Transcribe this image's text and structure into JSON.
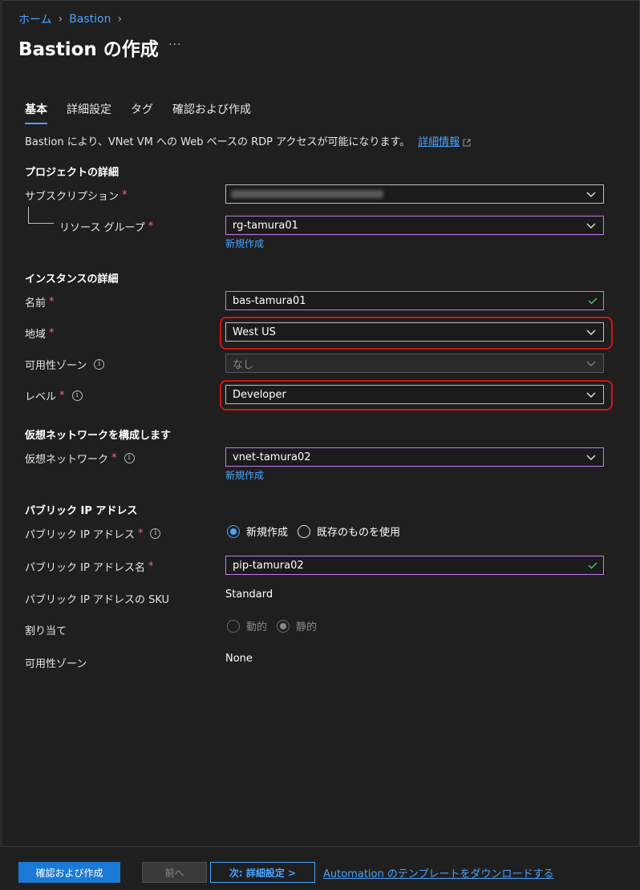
{
  "breadcrumb": {
    "home": "ホーム",
    "sep": "›",
    "bastion": "Bastion"
  },
  "page_title": "Bastion の作成",
  "more_label": "···",
  "tabs": [
    {
      "label": "基本",
      "active": true
    },
    {
      "label": "詳細設定",
      "active": false
    },
    {
      "label": "タグ",
      "active": false
    },
    {
      "label": "確認および作成",
      "active": false
    }
  ],
  "intro": {
    "text": "Bastion により、VNet VM への Web ベースの RDP アクセスが可能になります。",
    "link": "詳細情報"
  },
  "sections": {
    "project": "プロジェクトの詳細",
    "instance": "インスタンスの詳細",
    "vnet": "仮想ネットワークを構成します",
    "public_ip": "パブリック IP アドレス"
  },
  "fields": {
    "subscription": {
      "label": "サブスクリプション",
      "required": "*"
    },
    "resource_group": {
      "label": "リソース グループ",
      "required": "*",
      "value": "rg-tamura01",
      "new_link": "新規作成"
    },
    "name": {
      "label": "名前",
      "required": "*",
      "value": "bas-tamura01"
    },
    "region": {
      "label": "地域",
      "required": "*",
      "value": "West US"
    },
    "availability_zone": {
      "label": "可用性ゾーン",
      "value": "なし"
    },
    "tier": {
      "label": "レベル",
      "required": "*",
      "value": "Developer"
    },
    "virtual_network": {
      "label": "仮想ネットワーク",
      "required": "*",
      "value": "vnet-tamura02",
      "new_link": "新規作成"
    },
    "public_ip": {
      "label": "パブリック IP アドレス",
      "required": "*",
      "option_new": "新規作成",
      "option_existing": "既存のものを使用"
    },
    "public_ip_name": {
      "label": "パブリック IP アドレス名",
      "required": "*",
      "value": "pip-tamura02"
    },
    "public_ip_sku": {
      "label": "パブリック IP アドレスの SKU",
      "value": "Standard"
    },
    "assignment": {
      "label": "割り当て",
      "option_dynamic": "動的",
      "option_static": "静的"
    },
    "ip_zone": {
      "label": "可用性ゾーン",
      "value": "None"
    }
  },
  "footer": {
    "review_create": "確認および作成",
    "previous": "前へ",
    "next": "次: 詳細設定 >",
    "automation_link": "Automation のテンプレートをダウンロードする"
  },
  "colors": {
    "accent": "#4aa3ff",
    "primary_button": "#1b7ad6",
    "required": "#f1707b",
    "highlight_box": "#d41515",
    "focus_border": "#c27bf0"
  }
}
